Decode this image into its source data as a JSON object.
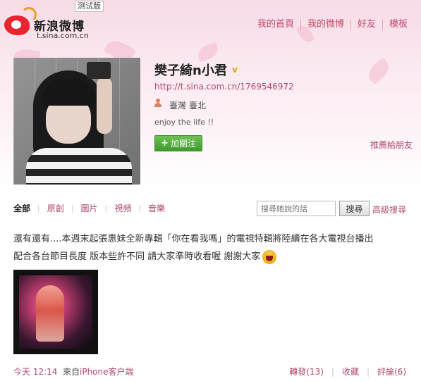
{
  "header": {
    "logo_name": "新浪微博",
    "logo_url": "t.sina.com.cn",
    "beta_badge": "测试版",
    "nav": [
      {
        "label": "我的首頁"
      },
      {
        "label": "我的微博"
      },
      {
        "label": "好友"
      },
      {
        "label": "模板"
      }
    ]
  },
  "profile": {
    "name": "樊子綺n小君",
    "verified_mark": "v",
    "url": "http://t.sina.com.cn/1769546972",
    "location": "臺灣 臺北",
    "bio": "enjoy the life !!",
    "follow_label": "加關注",
    "recommend_label": "推薦給朋友"
  },
  "tabs": [
    {
      "label": "全部",
      "active": true
    },
    {
      "label": "原創"
    },
    {
      "label": "圖片"
    },
    {
      "label": "視頻"
    },
    {
      "label": "音樂"
    }
  ],
  "search": {
    "placeholder": "搜尋她說的話",
    "button_label": "搜尋",
    "advanced_label": "高級搜尋"
  },
  "post": {
    "text_line1": "還有還有....本週末起張惠妹全新專輯「你在看我嗎」的電視特輯將陸續在各大電視台播出",
    "text_line2": "配合各台節目長度 版本些許不同 請大家準時收看喔 謝謝大家",
    "time": "今天 12:14",
    "from_label": "來自",
    "from_source": "iPhone客户端",
    "repost_label": "轉發(13)",
    "favorite_label": "收藏",
    "comment_label": "評論(6)"
  },
  "colors": {
    "accent": "#b04a6e",
    "follow_green": "#4aa834",
    "banner_pink": "#f7dbe6"
  }
}
